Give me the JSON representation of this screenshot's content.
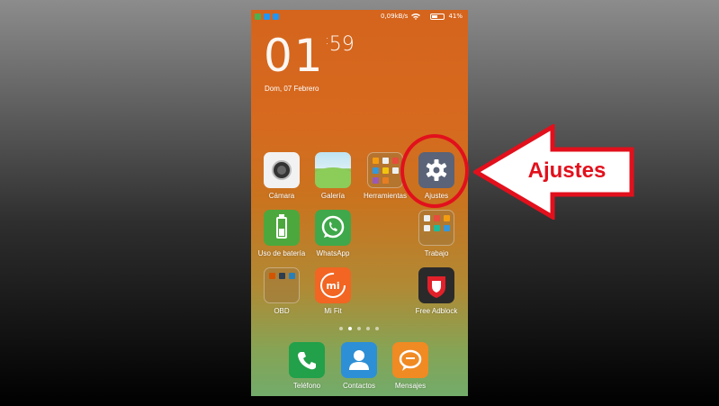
{
  "statusbar": {
    "speed": "0,09kB/s",
    "battery_percent": "41%",
    "battery_level": 0.41,
    "left_icon_colors": [
      "#4caf50",
      "#2196f3",
      "#2196f3"
    ]
  },
  "lockscreen": {
    "hours": "01",
    "minutes": "59",
    "date": "Dom, 07 Febrero"
  },
  "apps": {
    "camara": "Cámara",
    "galeria": "Galería",
    "herramientas": "Herramientas",
    "ajustes": "Ajustes",
    "uso_bateria": "Uso de batería",
    "whatsapp": "WhatsApp",
    "trabajo": "Trabajo",
    "obd": "OBD",
    "mi_fit": "Mi Fit",
    "free_adblock": "Free Adblock"
  },
  "dock": {
    "telefono": "Teléfono",
    "contactos": "Contactos",
    "mensajes": "Mensajes"
  },
  "pager": {
    "pages": 5,
    "active": 2
  },
  "annotation": {
    "label": "Ajustes",
    "color": "#e2101c"
  },
  "colors": {
    "ajustes_icon": "#5a6378",
    "whatsapp": "#3fa84a",
    "phone": "#22a04a",
    "contacts": "#2d8fd6",
    "messages": "#f08a23"
  }
}
